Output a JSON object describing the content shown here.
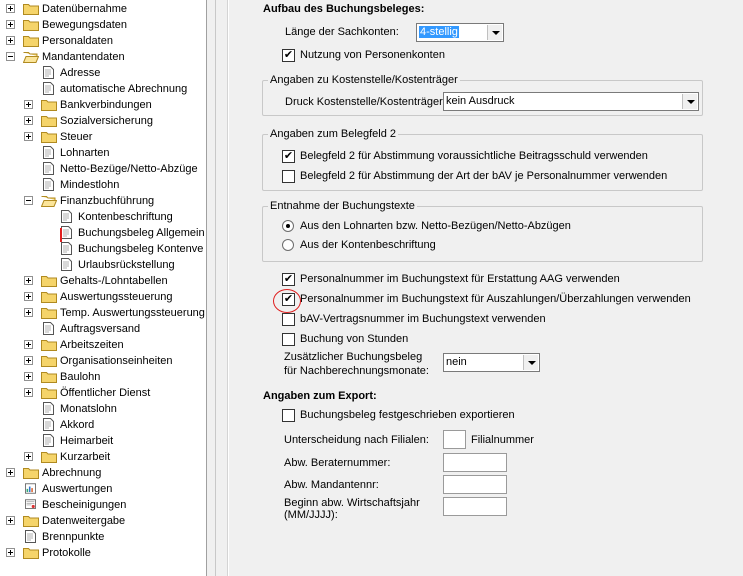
{
  "tree": {
    "items": [
      {
        "label": "Datenübernahme",
        "level": 0,
        "expander": "plus",
        "icon": "folder-icon"
      },
      {
        "label": "Bewegungsdaten",
        "level": 0,
        "expander": "plus",
        "icon": "folder-icon"
      },
      {
        "label": "Personaldaten",
        "level": 0,
        "expander": "plus",
        "icon": "folder-icon"
      },
      {
        "label": "Mandantendaten",
        "level": 0,
        "expander": "minus",
        "icon": "folder-open-icon"
      },
      {
        "label": "Adresse",
        "level": 1,
        "expander": "",
        "icon": "document-icon"
      },
      {
        "label": "automatische Abrechnung",
        "level": 1,
        "expander": "",
        "icon": "document-icon"
      },
      {
        "label": "Bankverbindungen",
        "level": 1,
        "expander": "plus",
        "icon": "folder-icon"
      },
      {
        "label": "Sozialversicherung",
        "level": 1,
        "expander": "plus",
        "icon": "folder-icon"
      },
      {
        "label": "Steuer",
        "level": 1,
        "expander": "plus",
        "icon": "folder-icon"
      },
      {
        "label": "Lohnarten",
        "level": 1,
        "expander": "",
        "icon": "document-icon"
      },
      {
        "label": "Netto-Bezüge/Netto-Abzüge",
        "level": 1,
        "expander": "",
        "icon": "document-icon"
      },
      {
        "label": "Mindestlohn",
        "level": 1,
        "expander": "",
        "icon": "document-icon"
      },
      {
        "label": "Finanzbuchführung",
        "level": 1,
        "expander": "minus",
        "icon": "folder-open-icon"
      },
      {
        "label": "Kontenbeschriftung",
        "level": 2,
        "expander": "",
        "icon": "document-icon"
      },
      {
        "label": "Buchungsbeleg Allgemein",
        "level": 2,
        "expander": "",
        "icon": "document-icon"
      },
      {
        "label": "Buchungsbeleg Kontenve",
        "level": 2,
        "expander": "",
        "icon": "document-icon"
      },
      {
        "label": "Urlaubsrückstellung",
        "level": 2,
        "expander": "",
        "icon": "document-icon"
      },
      {
        "label": "Gehalts-/Lohntabellen",
        "level": 1,
        "expander": "plus",
        "icon": "folder-icon"
      },
      {
        "label": "Auswertungssteuerung",
        "level": 1,
        "expander": "plus",
        "icon": "folder-icon"
      },
      {
        "label": "Temp. Auswertungssteuerung",
        "level": 1,
        "expander": "plus",
        "icon": "folder-icon"
      },
      {
        "label": "Auftragsversand",
        "level": 1,
        "expander": "",
        "icon": "document-icon"
      },
      {
        "label": "Arbeitszeiten",
        "level": 1,
        "expander": "plus",
        "icon": "folder-icon"
      },
      {
        "label": "Organisationseinheiten",
        "level": 1,
        "expander": "plus",
        "icon": "folder-icon"
      },
      {
        "label": "Baulohn",
        "level": 1,
        "expander": "plus",
        "icon": "folder-icon"
      },
      {
        "label": "Öffentlicher Dienst",
        "level": 1,
        "expander": "plus",
        "icon": "folder-icon"
      },
      {
        "label": "Monatslohn",
        "level": 1,
        "expander": "",
        "icon": "document-icon"
      },
      {
        "label": "Akkord",
        "level": 1,
        "expander": "",
        "icon": "document-icon"
      },
      {
        "label": "Heimarbeit",
        "level": 1,
        "expander": "",
        "icon": "document-icon"
      },
      {
        "label": "Kurzarbeit",
        "level": 1,
        "expander": "plus",
        "icon": "folder-icon"
      },
      {
        "label": "Abrechnung",
        "level": 0,
        "expander": "plus",
        "icon": "folder-icon"
      },
      {
        "label": "Auswertungen",
        "level": 0,
        "expander": "",
        "icon": "report-icon"
      },
      {
        "label": "Bescheinigungen",
        "level": 0,
        "expander": "",
        "icon": "certificate-icon"
      },
      {
        "label": "Datenweitergabe",
        "level": 0,
        "expander": "plus",
        "icon": "folder-icon"
      },
      {
        "label": "Brennpunkte",
        "level": 0,
        "expander": "",
        "icon": "document-icon"
      },
      {
        "label": "Protokolle",
        "level": 0,
        "expander": "plus",
        "icon": "folder-icon"
      }
    ]
  },
  "form": {
    "section1_title": "Aufbau des Buchungsbeleges:",
    "sachkonten_label": "Länge der Sachkonten:",
    "sachkonten_value": "4-stellig",
    "personenkonten_label": "Nutzung von Personenkonten",
    "personenkonten_checked": true,
    "kostenstelle_group": "Angaben zu Kostenstelle/Kostenträger",
    "kostenstelle_label": "Druck Kostenstelle/Kostenträger:",
    "kostenstelle_value": "kein Ausdruck",
    "belegfeld_group": "Angaben zum Belegfeld 2",
    "belegfeld_opt1": "Belegfeld 2 für Abstimmung voraussichtliche Beitragsschuld verwenden",
    "belegfeld_opt1_checked": true,
    "belegfeld_opt2": "Belegfeld 2 für Abstimmung der Art der bAV je Personalnummer verwenden",
    "belegfeld_opt2_checked": false,
    "entnahme_group": "Entnahme der Buchungstexte",
    "entnahme_opt1": "Aus den Lohnarten bzw. Netto-Bezügen/Netto-Abzügen",
    "entnahme_opt1_selected": true,
    "entnahme_opt2": "Aus der Kontenbeschriftung",
    "entnahme_opt2_selected": false,
    "chk_aag": "Personalnummer im Buchungstext für Erstattung AAG verwenden",
    "chk_aag_checked": true,
    "chk_auszahlung": "Personalnummer im Buchungstext für Auszahlungen/Überzahlungen verwenden",
    "chk_auszahlung_checked": true,
    "chk_bav": "bAV-Vertragsnummer im Buchungstext verwenden",
    "chk_bav_checked": false,
    "chk_stunden": "Buchung von Stunden",
    "chk_stunden_checked": false,
    "zusatz_label_1": "Zusätzlicher Buchungsbeleg",
    "zusatz_label_2": "für Nachberechnungsmonate:",
    "zusatz_value": "nein",
    "export_title": "Angaben zum Export:",
    "export_chk": "Buchungsbeleg festgeschrieben exportieren",
    "export_chk_checked": false,
    "filialen_label": "Unterscheidung nach Filialen:",
    "filialen_suffix": "Filialnummer",
    "berater_label": "Abw. Beraternummer:",
    "mandant_label": "Abw. Mandantennr:",
    "wj_label_1": "Beginn abw. Wirtschaftsjahr",
    "wj_label_2": "(MM/JJJJ):"
  },
  "checkmark_glyph": "✔",
  "accent_selection": "#3399ff",
  "annotation_color": "#e02020"
}
